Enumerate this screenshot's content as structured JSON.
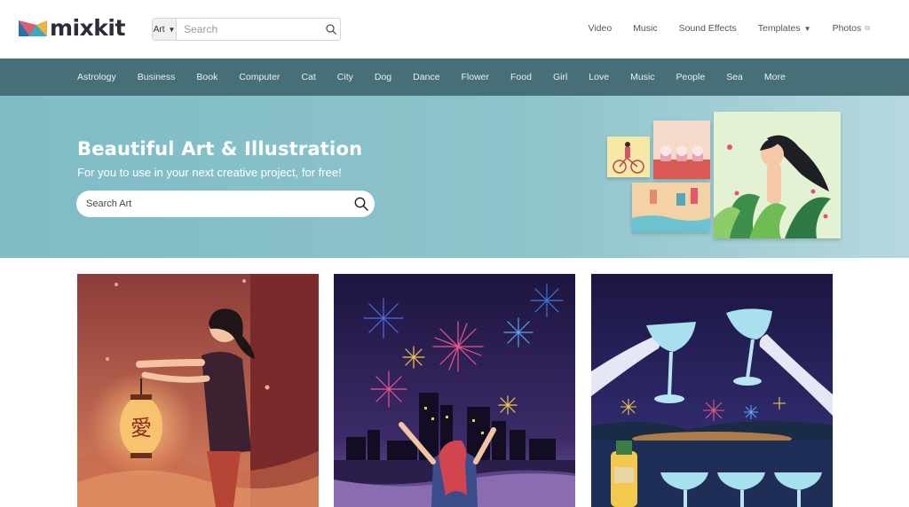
{
  "brand": {
    "logo_text": "mixkit"
  },
  "search": {
    "category": "Art",
    "placeholder": "Search"
  },
  "topnav": [
    {
      "label": "Video"
    },
    {
      "label": "Music"
    },
    {
      "label": "Sound Effects"
    },
    {
      "label": "Templates"
    },
    {
      "label": "Photos"
    }
  ],
  "categories": [
    "Astrology",
    "Business",
    "Book",
    "Computer",
    "Cat",
    "City",
    "Dog",
    "Dance",
    "Flower",
    "Food",
    "Girl",
    "Love",
    "Music",
    "People",
    "Sea",
    "More"
  ],
  "hero": {
    "title": "Beautiful Art & Illustration",
    "subtitle": "For you to use in your next creative project, for free!",
    "search_placeholder": "Search Art"
  },
  "cards": [
    {
      "glyph": "愛"
    },
    {},
    {}
  ],
  "colors": {
    "category_bar": "#466f78",
    "hero_bg": "#7fbcc6"
  }
}
